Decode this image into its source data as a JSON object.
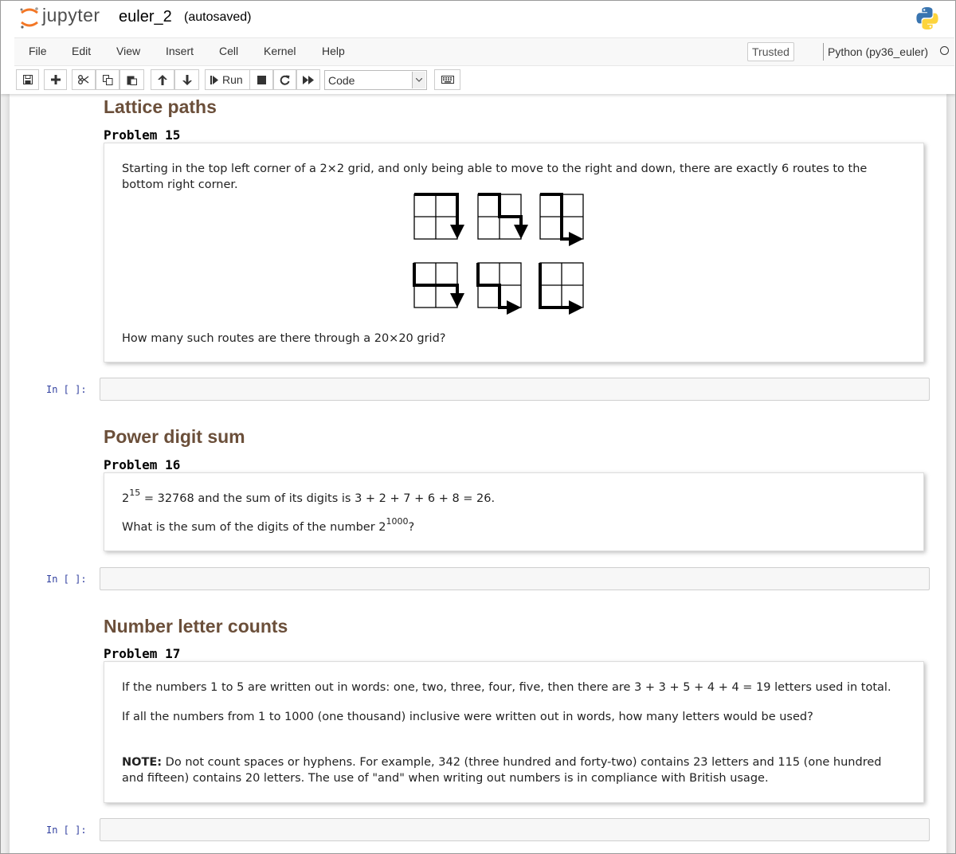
{
  "header": {
    "logo_text": "jupyter",
    "notebook_name": "euler_2",
    "save_status": "(autosaved)"
  },
  "menu": {
    "items": [
      "File",
      "Edit",
      "View",
      "Insert",
      "Cell",
      "Kernel",
      "Help"
    ],
    "trusted": "Trusted",
    "kernel": "Python (py36_euler)"
  },
  "toolbar": {
    "run_label": "Run",
    "cell_type": "Code"
  },
  "cells": {
    "p15": {
      "title": "Lattice paths",
      "problem": "Problem 15",
      "text1": "Starting in the top left corner of a 2×2 grid, and only being able to move to the right and down, there are exactly 6 routes to the bottom right corner.",
      "text2": "How many such routes are there through a 20×20 grid?"
    },
    "prompt1": "In [ ]:",
    "p16": {
      "title": "Power digit sum",
      "problem": "Problem 16",
      "base1": "2",
      "exp1": "15",
      "rest1": " = 32768 and the sum of its digits is 3 + 2 + 7 + 6 + 8 = 26.",
      "text2a": "What is the sum of the digits of the number 2",
      "exp2": "1000",
      "text2b": "?"
    },
    "prompt2": "In [ ]:",
    "p17": {
      "title": "Number letter counts",
      "problem": "Problem 17",
      "text1": "If the numbers 1 to 5 are written out in words: one, two, three, four, five, then there are 3 + 3 + 5 + 4 + 4 = 19 letters used in total.",
      "text2": "If all the numbers from 1 to 1000 (one thousand) inclusive were written out in words, how many letters would be used?",
      "note_label": "NOTE:",
      "note_text": " Do not count spaces or hyphens. For example, 342 (three hundred and forty-two) contains 23 letters and 115 (one hundred and fifteen) contains 20 letters. The use of \"and\" when writing out numbers is in compliance with British usage."
    },
    "prompt3": "In [ ]:"
  }
}
